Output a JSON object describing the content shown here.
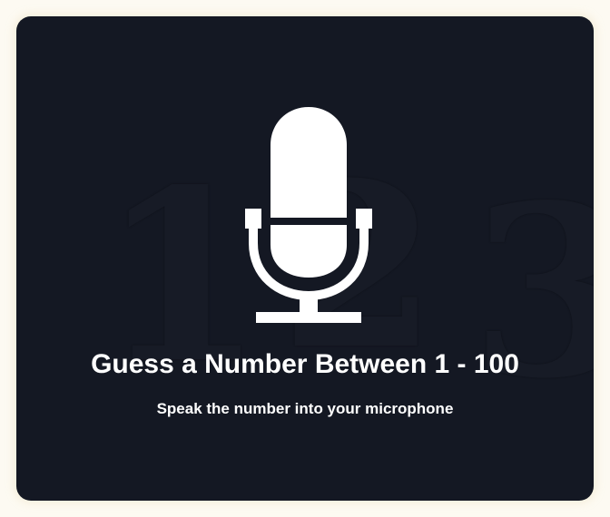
{
  "background_digits": [
    "1",
    "2",
    "3"
  ],
  "microphone": {
    "icon": "microphone-icon"
  },
  "title": "Guess a Number Between 1 - 100",
  "subtitle": "Speak the number into your microphone",
  "colors": {
    "card_background": "#141823",
    "page_background": "#fdfaf2",
    "text": "#ffffff"
  }
}
